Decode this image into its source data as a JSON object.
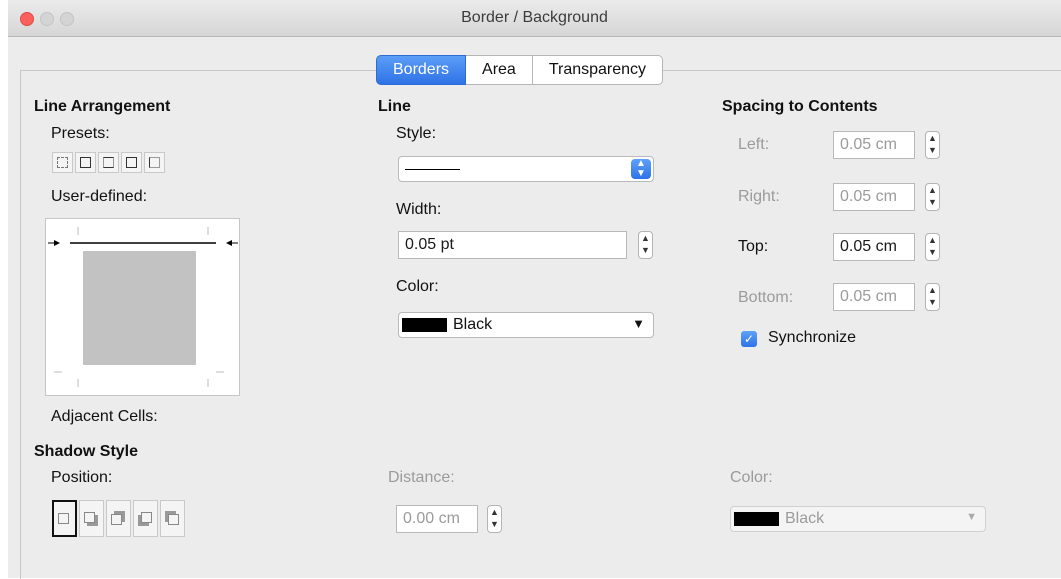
{
  "window": {
    "title": "Border / Background"
  },
  "tabs": [
    {
      "label": "Borders",
      "active": true
    },
    {
      "label": "Area",
      "active": false
    },
    {
      "label": "Transparency",
      "active": false
    }
  ],
  "line_arrangement": {
    "heading": "Line Arrangement",
    "presets_label": "Presets:",
    "user_defined_label": "User-defined:",
    "adjacent_cells_label": "Adjacent Cells:"
  },
  "line": {
    "heading": "Line",
    "style_label": "Style:",
    "width_label": "Width:",
    "width_value": "0.05 pt",
    "color_label": "Color:",
    "color_value": "Black"
  },
  "spacing": {
    "heading": "Spacing to Contents",
    "left_label": "Left:",
    "left_value": "0.05 cm",
    "right_label": "Right:",
    "right_value": "0.05 cm",
    "top_label": "Top:",
    "top_value": "0.05 cm",
    "bottom_label": "Bottom:",
    "bottom_value": "0.05 cm",
    "synchronize_label": "Synchronize",
    "synchronize_checked": true
  },
  "shadow": {
    "heading": "Shadow Style",
    "position_label": "Position:",
    "distance_label": "Distance:",
    "distance_value": "0.00 cm",
    "color_label": "Color:",
    "color_value": "Black"
  },
  "colors": {
    "accent": "#2f72e6",
    "swatch_black": "#000000",
    "close": "#fc605c"
  }
}
